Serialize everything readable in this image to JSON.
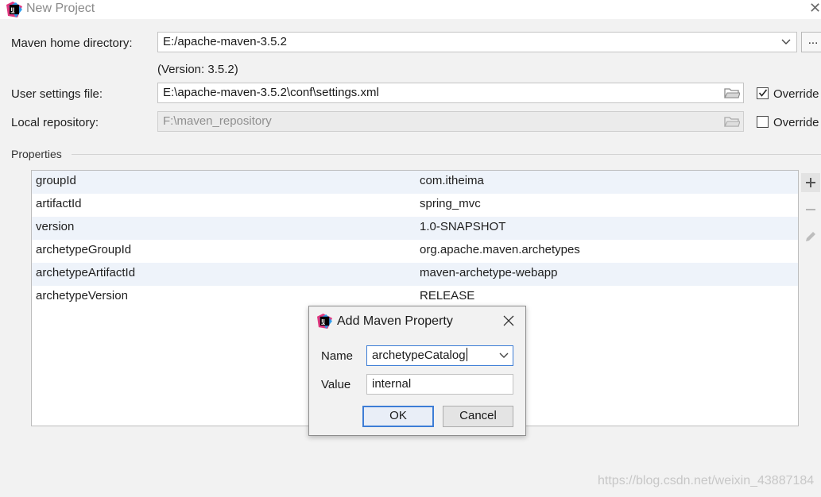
{
  "window": {
    "title": "New Project",
    "logo_text": "IJ"
  },
  "maven": {
    "home_label": "Maven home directory:",
    "home_value": "E:/apache-maven-3.5.2",
    "browse_label": "...",
    "version_text": "(Version: 3.5.2)",
    "settings_label": "User settings file:",
    "settings_value": "E:\\apache-maven-3.5.2\\conf\\settings.xml",
    "settings_override_label": "Override",
    "settings_override_checked": true,
    "repo_label": "Local repository:",
    "repo_value": "F:\\maven_repository",
    "repo_override_label": "Override",
    "repo_override_checked": false
  },
  "properties": {
    "section_title": "Properties",
    "rows": [
      {
        "key": "groupId",
        "value": "com.itheima"
      },
      {
        "key": "artifactId",
        "value": "spring_mvc"
      },
      {
        "key": "version",
        "value": "1.0-SNAPSHOT"
      },
      {
        "key": "archetypeGroupId",
        "value": "org.apache.maven.archetypes"
      },
      {
        "key": "archetypeArtifactId",
        "value": "maven-archetype-webapp"
      },
      {
        "key": "archetypeVersion",
        "value": "RELEASE"
      }
    ],
    "tools": [
      "plus-icon",
      "minus-icon",
      "pencil-icon"
    ]
  },
  "dialog": {
    "title": "Add Maven Property",
    "logo_text": "IJ",
    "name_label": "Name",
    "name_value": "archetypeCatalog",
    "value_label": "Value",
    "value_value": "internal",
    "ok_label": "OK",
    "cancel_label": "Cancel"
  },
  "watermark": "https://blog.csdn.net/weixin_43887184",
  "colors": {
    "accent": "#3d7dd6",
    "row_alt": "#eef3fa",
    "background": "#f2f2f2"
  }
}
